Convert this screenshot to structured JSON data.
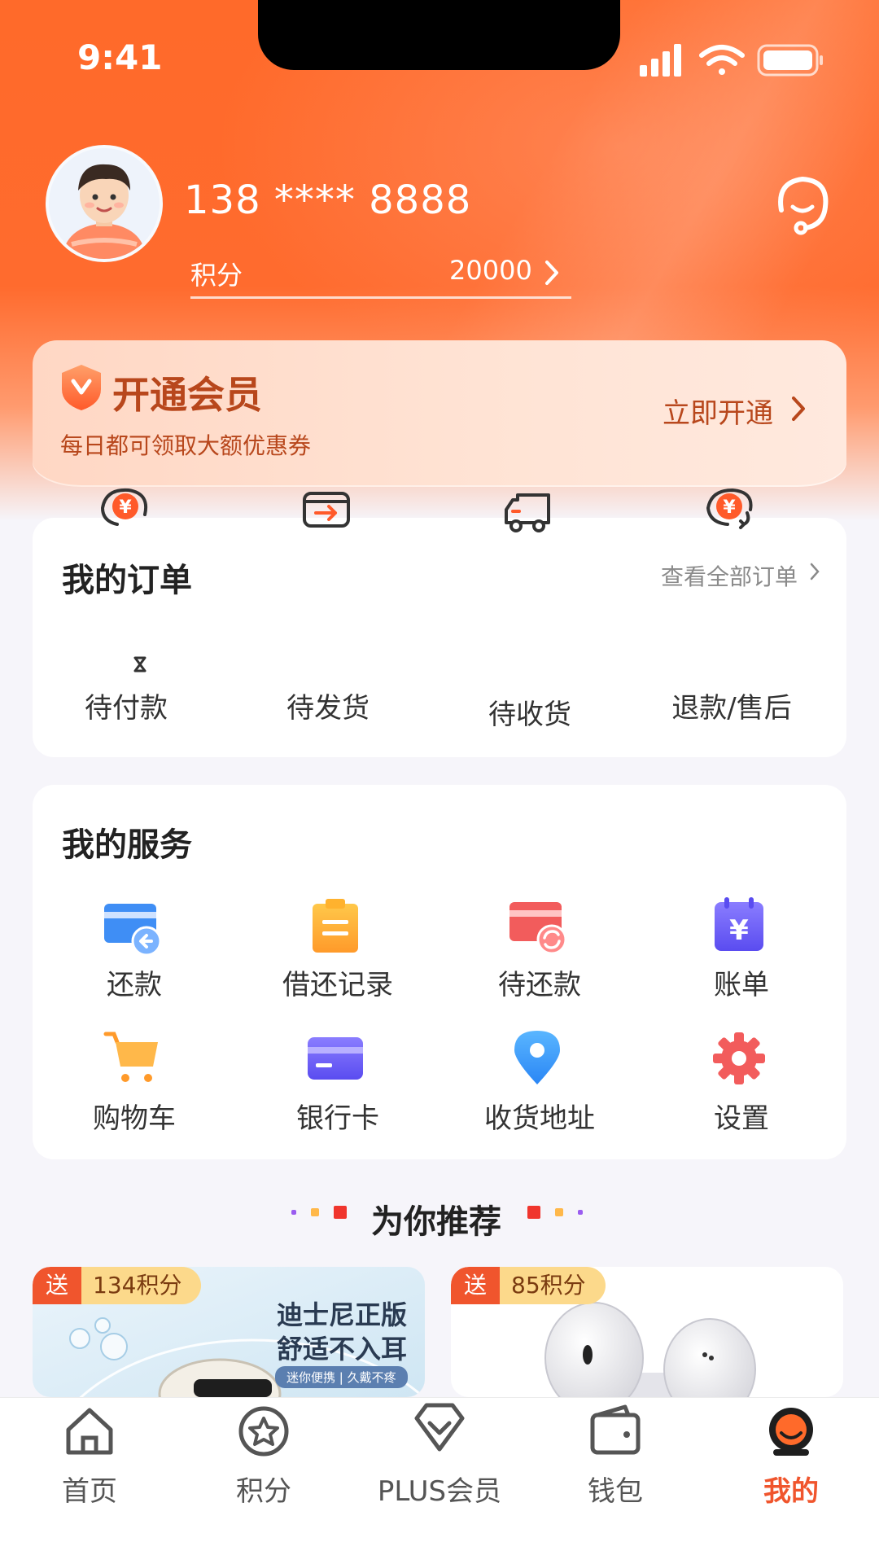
{
  "status_bar": {
    "time": "9:41"
  },
  "profile": {
    "phone": "138 **** 8888",
    "points_label": "积分",
    "points_value": "20000"
  },
  "member_banner": {
    "title": "开通会员",
    "subtitle": "每日都可领取大额优惠券",
    "cta": "立即开通"
  },
  "orders": {
    "title": "我的订单",
    "view_all": "查看全部订单",
    "items": [
      {
        "label": "待付款",
        "icon": "payment-pending-icon"
      },
      {
        "label": "待发货",
        "icon": "to-ship-icon"
      },
      {
        "label": "待收货",
        "icon": "delivery-truck-icon"
      },
      {
        "label": "退款/售后",
        "icon": "refund-icon"
      }
    ]
  },
  "services": {
    "title": "我的服务",
    "items": [
      {
        "label": "还款",
        "icon": "repay-card-icon"
      },
      {
        "label": "借还记录",
        "icon": "clipboard-icon"
      },
      {
        "label": "待还款",
        "icon": "pending-repay-icon"
      },
      {
        "label": "账单",
        "icon": "bill-calendar-icon"
      },
      {
        "label": "购物车",
        "icon": "cart-icon"
      },
      {
        "label": "银行卡",
        "icon": "bank-card-icon"
      },
      {
        "label": "收货地址",
        "icon": "location-pin-icon"
      },
      {
        "label": "设置",
        "icon": "gear-icon"
      }
    ]
  },
  "recommend": {
    "title": "为你推荐",
    "products": [
      {
        "badge_send": "送",
        "badge_points": "134积分",
        "headline_1": "迪士尼正版",
        "headline_2": "舒适不入耳",
        "tag": "迷你便携 | 久戴不疼"
      },
      {
        "badge_send": "送",
        "badge_points": "85积分"
      }
    ]
  },
  "tabbar": {
    "items": [
      {
        "label": "首页",
        "icon": "home-icon",
        "active": false
      },
      {
        "label": "积分",
        "icon": "star-circle-icon",
        "active": false
      },
      {
        "label": "PLUS会员",
        "icon": "diamond-icon",
        "active": false
      },
      {
        "label": "钱包",
        "icon": "wallet-icon",
        "active": false
      },
      {
        "label": "我的",
        "icon": "profile-icon",
        "active": true
      }
    ]
  },
  "colors": {
    "brand_orange": "#ff6a2a",
    "accent_red": "#f0552d",
    "member_text": "#b8471c"
  }
}
